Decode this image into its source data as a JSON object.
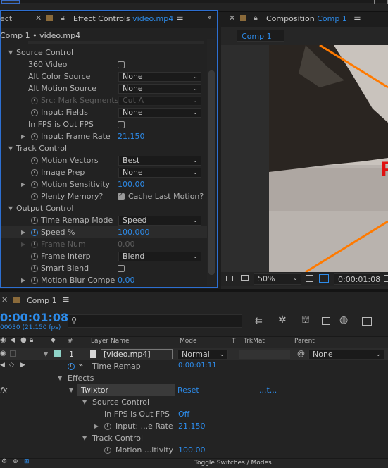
{
  "effect_controls": {
    "tab_left_partial": "ect",
    "tab_label": "Effect Controls",
    "tab_file": "video.mp4",
    "breadcrumb": "Comp 1 • video.mp4",
    "source_control": "Source Control",
    "v360": "360 Video",
    "alt_color": "Alt Color Source",
    "alt_color_val": "None",
    "alt_motion": "Alt Motion Source",
    "alt_motion_val": "None",
    "src_mark": "Src: Mark Segments",
    "src_mark_val": "Cut A",
    "input_fields": "Input: Fields",
    "input_fields_val": "None",
    "in_fps": "In FPS is Out FPS",
    "input_frame_rate": "Input: Frame Rate",
    "input_frame_rate_val": "21.150",
    "track_control": "Track Control",
    "motion_vectors": "Motion Vectors",
    "motion_vectors_val": "Best",
    "image_prep": "Image Prep",
    "image_prep_val": "None",
    "motion_sens": "Motion Sensitivity",
    "motion_sens_val": "100.00",
    "plenty_mem": "Plenty Memory?",
    "cache_last": "Cache Last Motion?",
    "output_control": "Output Control",
    "time_remap_mode": "Time Remap Mode",
    "time_remap_mode_val": "Speed",
    "speed": "Speed %",
    "speed_val": "100.000",
    "frame_num": "Frame Num",
    "frame_num_val": "0.00",
    "frame_interp": "Frame Interp",
    "frame_interp_val": "Blend",
    "smart_blend": "Smart Blend",
    "motion_blur": "Motion Blur Compe",
    "motion_blur_val": "0.00"
  },
  "composition": {
    "tab_label": "Composition",
    "tab_comp": "Comp 1",
    "sub_tab": "Comp 1",
    "zoom": "50%",
    "timecode": "0:00:01:08"
  },
  "timeline": {
    "tab_label": "Comp 1",
    "timecode": "0:00:01:08",
    "frame_info": "00030 (21.150 fps)",
    "search_placeholder": "",
    "col_hash": "#",
    "col_layer": "Layer Name",
    "col_mode": "Mode",
    "col_t": "T",
    "col_trkmat": "TrkMat",
    "col_parent": "Parent",
    "layer_num": "1",
    "layer_name": "[video.mp4]",
    "layer_mode": "Normal",
    "layer_parent": "None",
    "time_remap": "Time Remap",
    "time_remap_val": "0:00:01:11",
    "effects": "Effects",
    "twixtor": "Twixtor",
    "reset": "Reset",
    "dots": "...t...",
    "source_control": "Source Control",
    "in_fps": "In FPS is Out FPS",
    "in_fps_val": "Off",
    "input_rate": "Input: ...e Rate",
    "input_rate_val": "21.150",
    "track_control": "Track Control",
    "motion_sens": "Motion ...itivity",
    "motion_sens_val": "100.00",
    "fx": "fx",
    "bottom_toggle": "Toggle Switches / Modes"
  },
  "preview_text": "F",
  "colors": {
    "accent_blue": "#2d8ceb",
    "orange_line": "#ff7a00",
    "teal_label": "#8fd3c8"
  }
}
